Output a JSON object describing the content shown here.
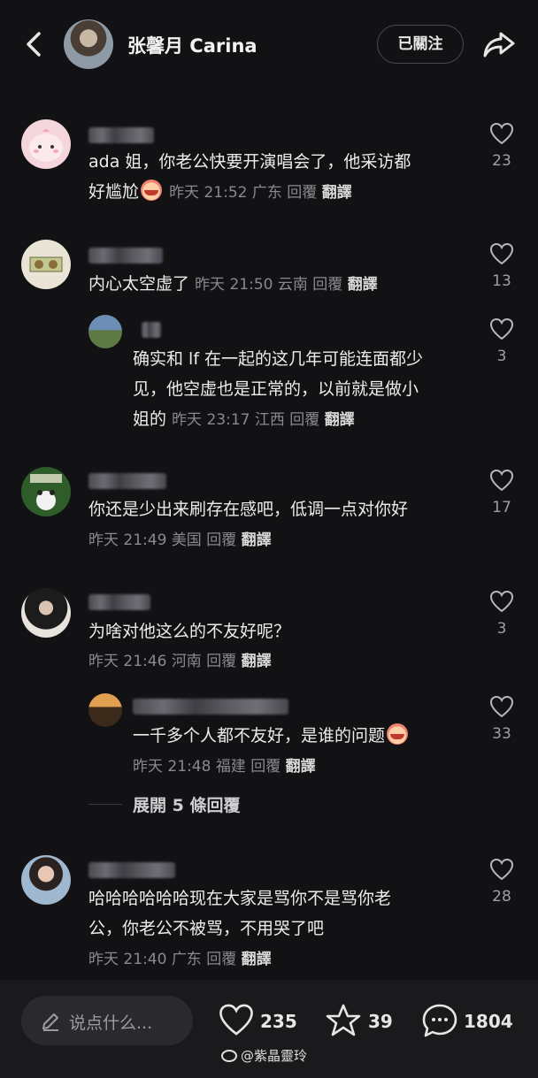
{
  "header": {
    "title": "张馨月 Carina",
    "follow_label": "已關注"
  },
  "comments": [
    {
      "lines": [
        "ada 姐，你老公快要开演唱会了，他采访都",
        "好尴尬"
      ],
      "time": "昨天 21:52",
      "location": "广东",
      "reply_label": "回覆",
      "translate_label": "翻譯",
      "likes": "23"
    },
    {
      "lines": [
        "内心太空虚了"
      ],
      "time": "昨天 21:50",
      "location": "云南",
      "reply_label": "回覆",
      "translate_label": "翻譯",
      "likes": "13"
    },
    {
      "lines": [
        "确实和 lf 在一起的这几年可能连面都少",
        "见，他空虚也是正常的，以前就是做小",
        "姐的"
      ],
      "time": "昨天 23:17",
      "location": "江西",
      "reply_label": "回覆",
      "translate_label": "翻譯",
      "likes": "3"
    },
    {
      "lines": [
        "你还是少出来刷存在感吧，低调一点对你好"
      ],
      "time": "昨天 21:49",
      "location": "美国",
      "reply_label": "回覆",
      "translate_label": "翻譯",
      "likes": "17"
    },
    {
      "lines": [
        "为啥对他这么的不友好呢？"
      ],
      "time": "昨天 21:46",
      "location": "河南",
      "reply_label": "回覆",
      "translate_label": "翻譯",
      "likes": "3"
    },
    {
      "lines": [
        "一千多个人都不友好，是谁的问题"
      ],
      "time": "昨天 21:48",
      "location": "福建",
      "reply_label": "回覆",
      "translate_label": "翻譯",
      "likes": "33"
    },
    {
      "lines": [
        "哈哈哈哈哈哈现在大家是骂你不是骂你老",
        "公，你老公不被骂，不用哭了吧"
      ],
      "time": "昨天 21:40",
      "location": "广东",
      "reply_label": "回覆",
      "translate_label": "翻譯",
      "likes": "28"
    }
  ],
  "expand_replies_label": "展開 5 條回覆",
  "bottom_bar": {
    "input_placeholder": "说点什么...",
    "likes": "235",
    "favorites": "39",
    "comments": "1804"
  },
  "watermark": "@紫晶靈玲",
  "colors": {
    "background": "#121214",
    "text": "#ececec",
    "meta": "#8a8a8e",
    "bottom_bar": "#1a1a1c"
  },
  "icons": [
    "back-icon",
    "share-icon",
    "heart-icon",
    "star-icon",
    "comment-icon",
    "pencil-icon",
    "crying-emoji-icon"
  ]
}
